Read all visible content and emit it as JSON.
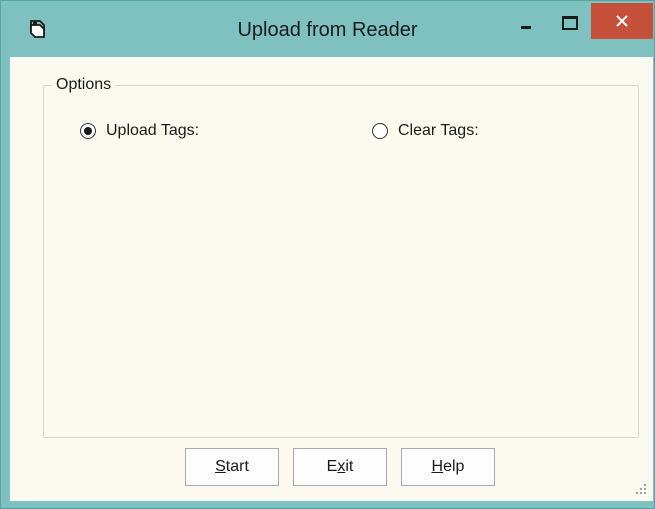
{
  "window": {
    "title": "Upload from Reader"
  },
  "titlebar": {
    "icon": "tag-reader-icon",
    "minimize": "minimize-icon",
    "maximize": "maximize-icon",
    "close": "close-icon"
  },
  "options": {
    "legend": "Options",
    "upload_tags": {
      "label": "Upload Tags:",
      "checked": true
    },
    "clear_tags": {
      "label": "Clear Tags:",
      "checked": false
    }
  },
  "buttons": {
    "start": {
      "mnemonic": "S",
      "rest": "tart"
    },
    "exit": {
      "pre": "E",
      "mnemonic": "x",
      "rest": "it"
    },
    "help": {
      "mnemonic": "H",
      "rest": "elp"
    }
  },
  "colors": {
    "frame": "#7fc1c1",
    "client": "#fcfaf0",
    "close": "#c7503a"
  }
}
